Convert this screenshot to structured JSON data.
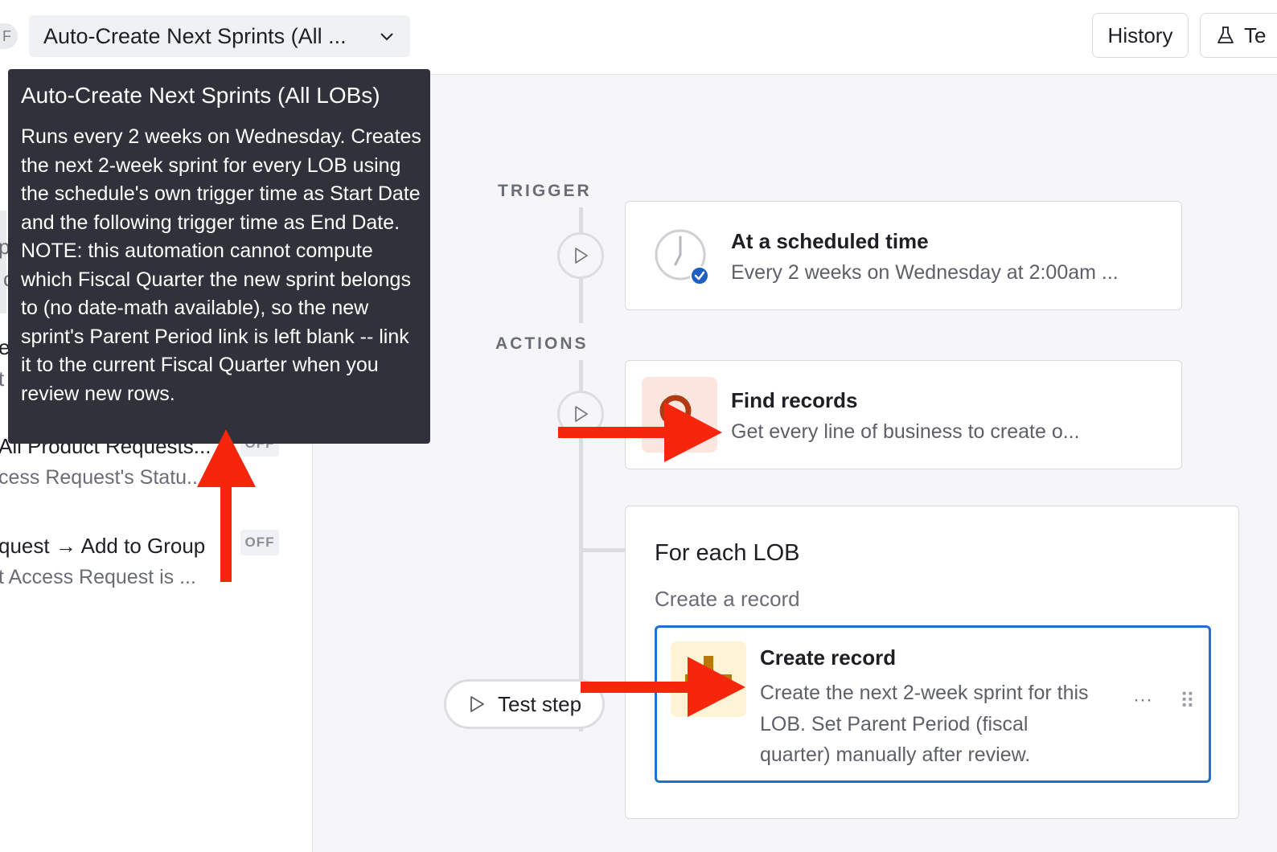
{
  "topbar": {
    "status_fragment": "F",
    "automation_name": "Auto-Create Next Sprints (All ...",
    "history_label": "History",
    "test_label": "Te"
  },
  "sidebar": {
    "fragments": {
      "p": "p",
      "c": "c",
      "e": "e",
      "t": "t"
    },
    "items": [
      {
        "title": "All Product Requests...",
        "desc": "cess Request's Statu...",
        "badge": "OFF"
      },
      {
        "title": "quest → Add to Group",
        "desc": "t Access Request is ...",
        "badge": "OFF"
      }
    ]
  },
  "tooltip": {
    "title": "Auto-Create Next Sprints (All LOBs)",
    "body": "Runs every 2 weeks on Wednesday. Creates the next 2-week sprint for every LOB using the schedule's own trigger time as Start Date and the following trigger time as End Date. NOTE: this automation cannot compute which Fiscal Quarter the new sprint belongs to (no date-math available), so the new sprint's Parent Period link is left blank -- link it to the current Fiscal Quarter when you review new rows."
  },
  "flow": {
    "trigger_label": "TRIGGER",
    "actions_label": "ACTIONS",
    "trigger_card": {
      "title": "At a scheduled time",
      "desc": "Every 2 weeks on Wednesday at 2:00am ..."
    },
    "find_card": {
      "title": "Find records",
      "desc": "Get every line of business to create o..."
    },
    "foreach": {
      "title": "For each LOB",
      "subtitle": "Create a record",
      "create_card": {
        "title": "Create record",
        "desc": "Create the next 2-week sprint for this LOB. Set Parent Period (fiscal quarter) manually after review.",
        "more_label": "···",
        "drag_label": "⠿"
      }
    },
    "test_step_label": "Test step"
  },
  "colors": {
    "accent_blue": "#1f6fd1",
    "annotation_red": "#f5260b",
    "tooltip_bg": "#2f323b",
    "find_icon_bg": "#fde6e0",
    "create_icon_bg": "#fff3d6"
  }
}
